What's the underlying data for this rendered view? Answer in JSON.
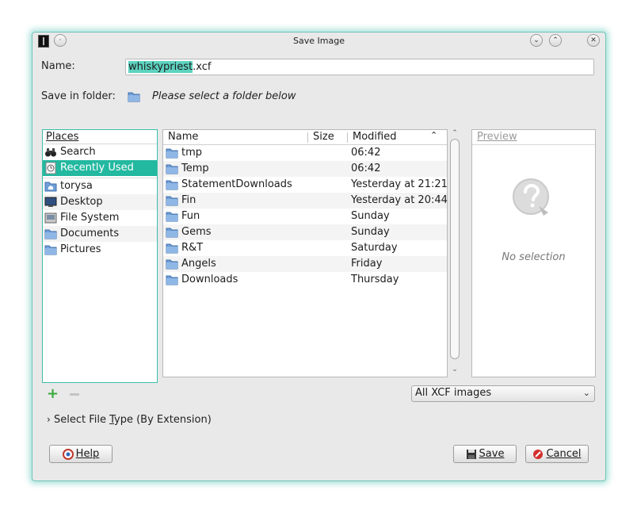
{
  "window": {
    "title": "Save Image"
  },
  "name_field": {
    "label": "Name:",
    "value_selected": "whiskypriest",
    "value_extension": ".xcf"
  },
  "save_in": {
    "label": "Save in folder:",
    "placeholder": "Please select a folder below"
  },
  "places": {
    "header": "Places",
    "items": [
      {
        "label": "Search",
        "icon": "binoculars-icon"
      },
      {
        "label": "Recently Used",
        "icon": "clock-icon",
        "selected": true
      },
      {
        "label": "torysa",
        "icon": "home-folder-icon"
      },
      {
        "label": "Desktop",
        "icon": "desktop-icon"
      },
      {
        "label": "File System",
        "icon": "drive-icon"
      },
      {
        "label": "Documents",
        "icon": "folder-icon"
      },
      {
        "label": "Pictures",
        "icon": "folder-icon"
      }
    ]
  },
  "files": {
    "columns": {
      "name": "Name",
      "size": "Size",
      "modified": "Modified"
    },
    "rows": [
      {
        "name": "tmp",
        "modified": "06:42"
      },
      {
        "name": "Temp",
        "modified": "06:42"
      },
      {
        "name": "StatementDownloads",
        "modified": "Yesterday at 21:21"
      },
      {
        "name": "Fin",
        "modified": "Yesterday at 20:44"
      },
      {
        "name": "Fun",
        "modified": "Sunday"
      },
      {
        "name": "Gems",
        "modified": "Sunday"
      },
      {
        "name": "R&T",
        "modified": "Saturday"
      },
      {
        "name": "Angels",
        "modified": "Friday"
      },
      {
        "name": "Downloads",
        "modified": "Thursday"
      }
    ]
  },
  "preview": {
    "header": "Preview",
    "empty_text": "No selection"
  },
  "filter": {
    "selected": "All XCF images"
  },
  "file_type_expander": {
    "label_prefix": "Select File ",
    "label_underline": "T",
    "label_suffix": "ype (By Extension)"
  },
  "buttons": {
    "help": "Help",
    "save": "Save",
    "cancel": "Cancel"
  },
  "colors": {
    "accent": "#23b8a0",
    "glow": "#5fc8b9",
    "folder": "#6f9fd8"
  }
}
